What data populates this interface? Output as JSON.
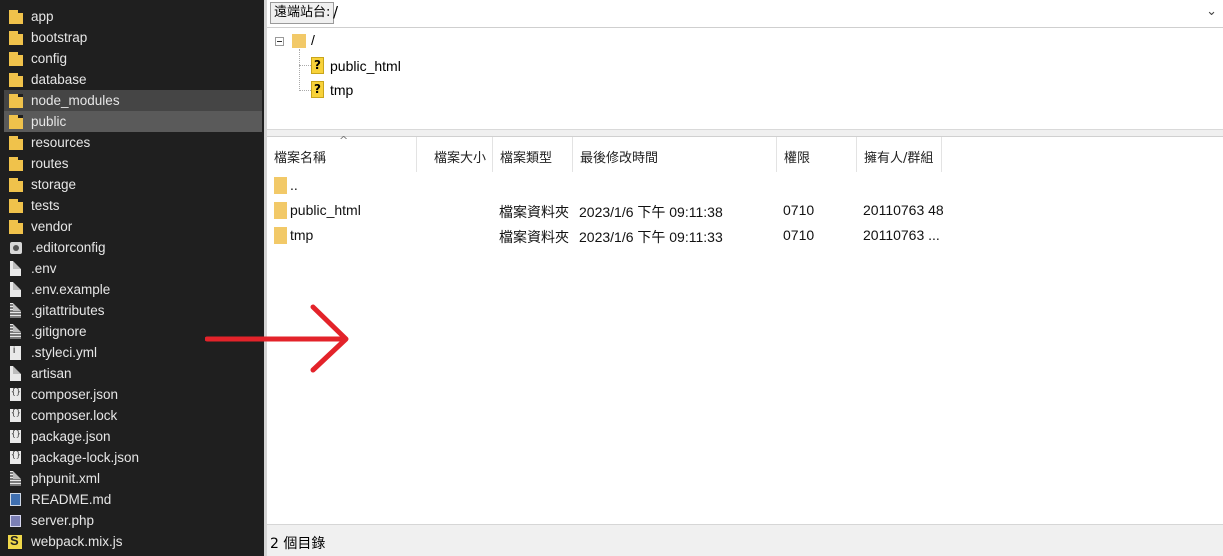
{
  "local_files": [
    {
      "name": "app",
      "icon": "folder-icon"
    },
    {
      "name": "bootstrap",
      "icon": "folder-icon"
    },
    {
      "name": "config",
      "icon": "folder-icon"
    },
    {
      "name": "database",
      "icon": "folder-icon"
    },
    {
      "name": "node_modules",
      "icon": "folder-icon"
    },
    {
      "name": "public",
      "icon": "folder-icon"
    },
    {
      "name": "resources",
      "icon": "folder-icon"
    },
    {
      "name": "routes",
      "icon": "folder-icon"
    },
    {
      "name": "storage",
      "icon": "folder-icon"
    },
    {
      "name": "tests",
      "icon": "folder-icon"
    },
    {
      "name": "vendor",
      "icon": "folder-icon"
    },
    {
      "name": ".editorconfig",
      "icon": "gear-file-icon"
    },
    {
      "name": ".env",
      "icon": "file-icon"
    },
    {
      "name": ".env.example",
      "icon": "file-icon"
    },
    {
      "name": ".gitattributes",
      "icon": "text-file-icon"
    },
    {
      "name": ".gitignore",
      "icon": "text-file-icon"
    },
    {
      "name": ".styleci.yml",
      "icon": "yml-file-icon"
    },
    {
      "name": "artisan",
      "icon": "file-icon"
    },
    {
      "name": "composer.json",
      "icon": "json-file-icon"
    },
    {
      "name": "composer.lock",
      "icon": "json-file-icon"
    },
    {
      "name": "package.json",
      "icon": "json-file-icon"
    },
    {
      "name": "package-lock.json",
      "icon": "json-file-icon"
    },
    {
      "name": "phpunit.xml",
      "icon": "text-file-icon"
    },
    {
      "name": "README.md",
      "icon": "markdown-file-icon"
    },
    {
      "name": "server.php",
      "icon": "php-file-icon"
    },
    {
      "name": "webpack.mix.js",
      "icon": "webpack-file-icon"
    }
  ],
  "remote": {
    "site_label": "遠端站台:",
    "path": "/",
    "tree_root": "/",
    "tree_children": [
      "public_html",
      "tmp"
    ]
  },
  "columns": [
    "檔案名稱",
    "檔案大小",
    "檔案類型",
    "最後修改時間",
    "權限",
    "擁有人/群組"
  ],
  "rows": [
    {
      "name": "..",
      "size": "",
      "type": "",
      "modified": "",
      "perm": "",
      "owner": ""
    },
    {
      "name": "public_html",
      "size": "",
      "type": "檔案資料夾",
      "modified": "2023/1/6 下午 09:11:38",
      "perm": "0710",
      "owner": "20110763 48"
    },
    {
      "name": "tmp",
      "size": "",
      "type": "檔案資料夾",
      "modified": "2023/1/6 下午 09:11:33",
      "perm": "0710",
      "owner": "20110763 ..."
    }
  ],
  "status_text": "2 個目錄",
  "colors": {
    "arrow": "#e3232a",
    "folder": "#f2c968",
    "left_bg": "#1f1f1f"
  }
}
